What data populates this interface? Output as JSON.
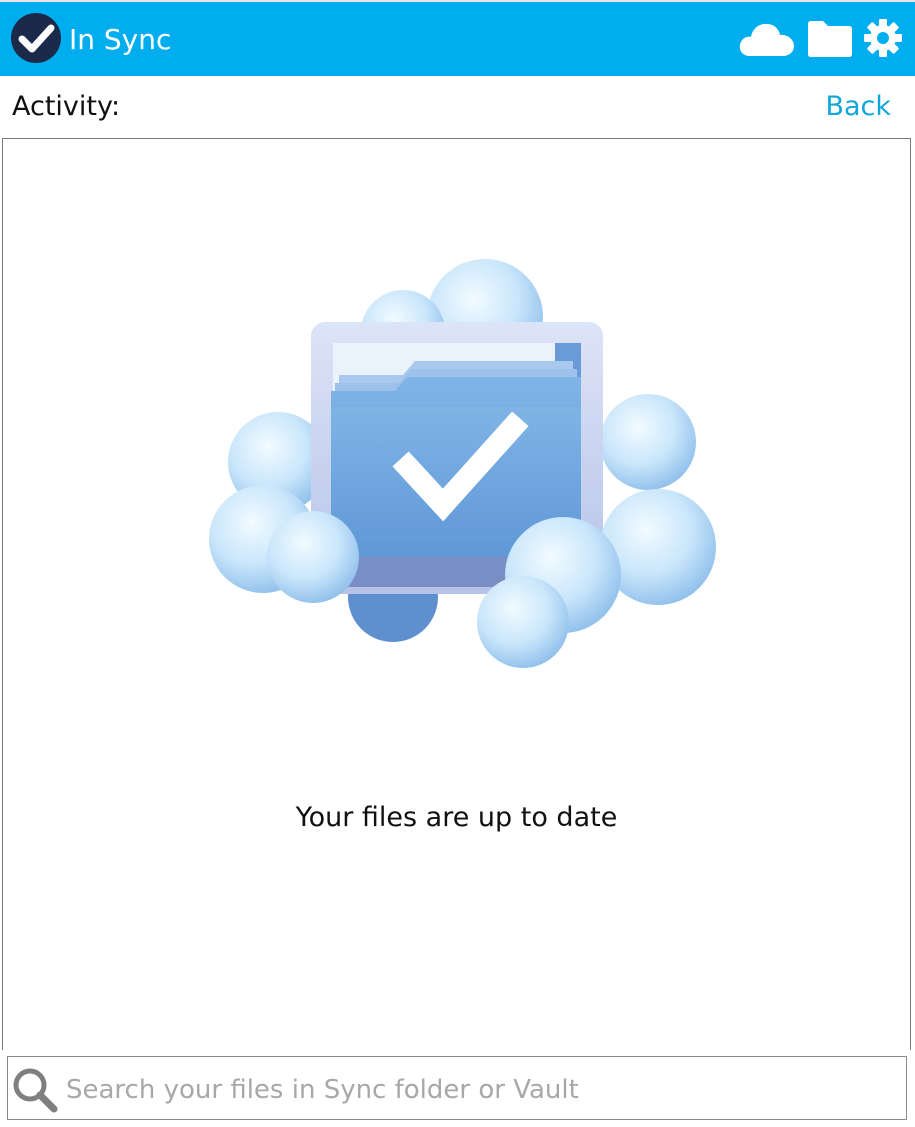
{
  "header": {
    "status_label": "In Sync",
    "status_icon": "checkmark-circle-icon",
    "buttons": [
      {
        "icon": "cloud-icon"
      },
      {
        "icon": "folder-icon"
      },
      {
        "icon": "gear-icon"
      }
    ],
    "background_color": "#00AEEF"
  },
  "activity": {
    "label": "Activity:",
    "back_label": "Back",
    "back_color": "#11A6D9"
  },
  "main": {
    "illustration_icon": "folder-cloud-check-illustration",
    "message": "Your files are up to date"
  },
  "search": {
    "placeholder": "Search your files in Sync folder or Vault",
    "value": "",
    "icon": "search-icon"
  }
}
